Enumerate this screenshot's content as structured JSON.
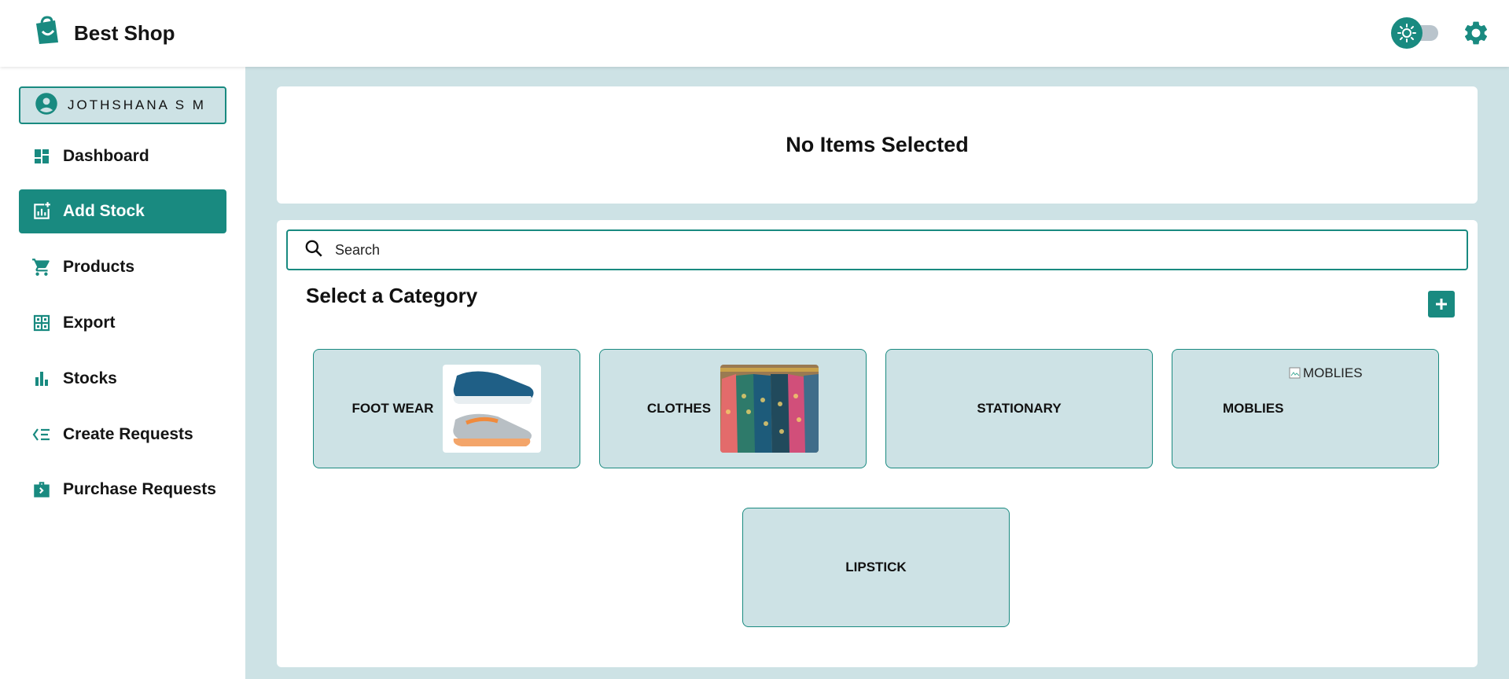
{
  "brand": {
    "name": "Best Shop",
    "accent": "#198a80"
  },
  "header": {
    "theme_toggle": "sun-icon",
    "settings": "gear-icon"
  },
  "sidebar": {
    "user": {
      "name": "JOTHSHANA S M"
    },
    "items": [
      {
        "label": "Dashboard",
        "icon": "dashboard-icon",
        "active": false
      },
      {
        "label": "Add Stock",
        "icon": "add-chart-icon",
        "active": true
      },
      {
        "label": "Products",
        "icon": "cart-icon",
        "active": false
      },
      {
        "label": "Export",
        "icon": "grid-icon",
        "active": false
      },
      {
        "label": "Stocks",
        "icon": "bar-chart-icon",
        "active": false
      },
      {
        "label": "Create Requests",
        "icon": "request-list-icon",
        "active": false
      },
      {
        "label": "Purchase Requests",
        "icon": "briefcase-arrow-icon",
        "active": false
      }
    ]
  },
  "main": {
    "selection_message": "No Items Selected",
    "search": {
      "placeholder": "Search",
      "value": ""
    },
    "section_title": "Select a Category",
    "categories": [
      {
        "label": "FOOT WEAR",
        "image": "shoes"
      },
      {
        "label": "CLOTHES",
        "image": "clothes-rack"
      },
      {
        "label": "STATIONARY",
        "image": ""
      },
      {
        "label": "MOBLIES",
        "image": "broken",
        "alt": "MOBLIES"
      },
      {
        "label": "LIPSTICK",
        "image": ""
      }
    ]
  }
}
